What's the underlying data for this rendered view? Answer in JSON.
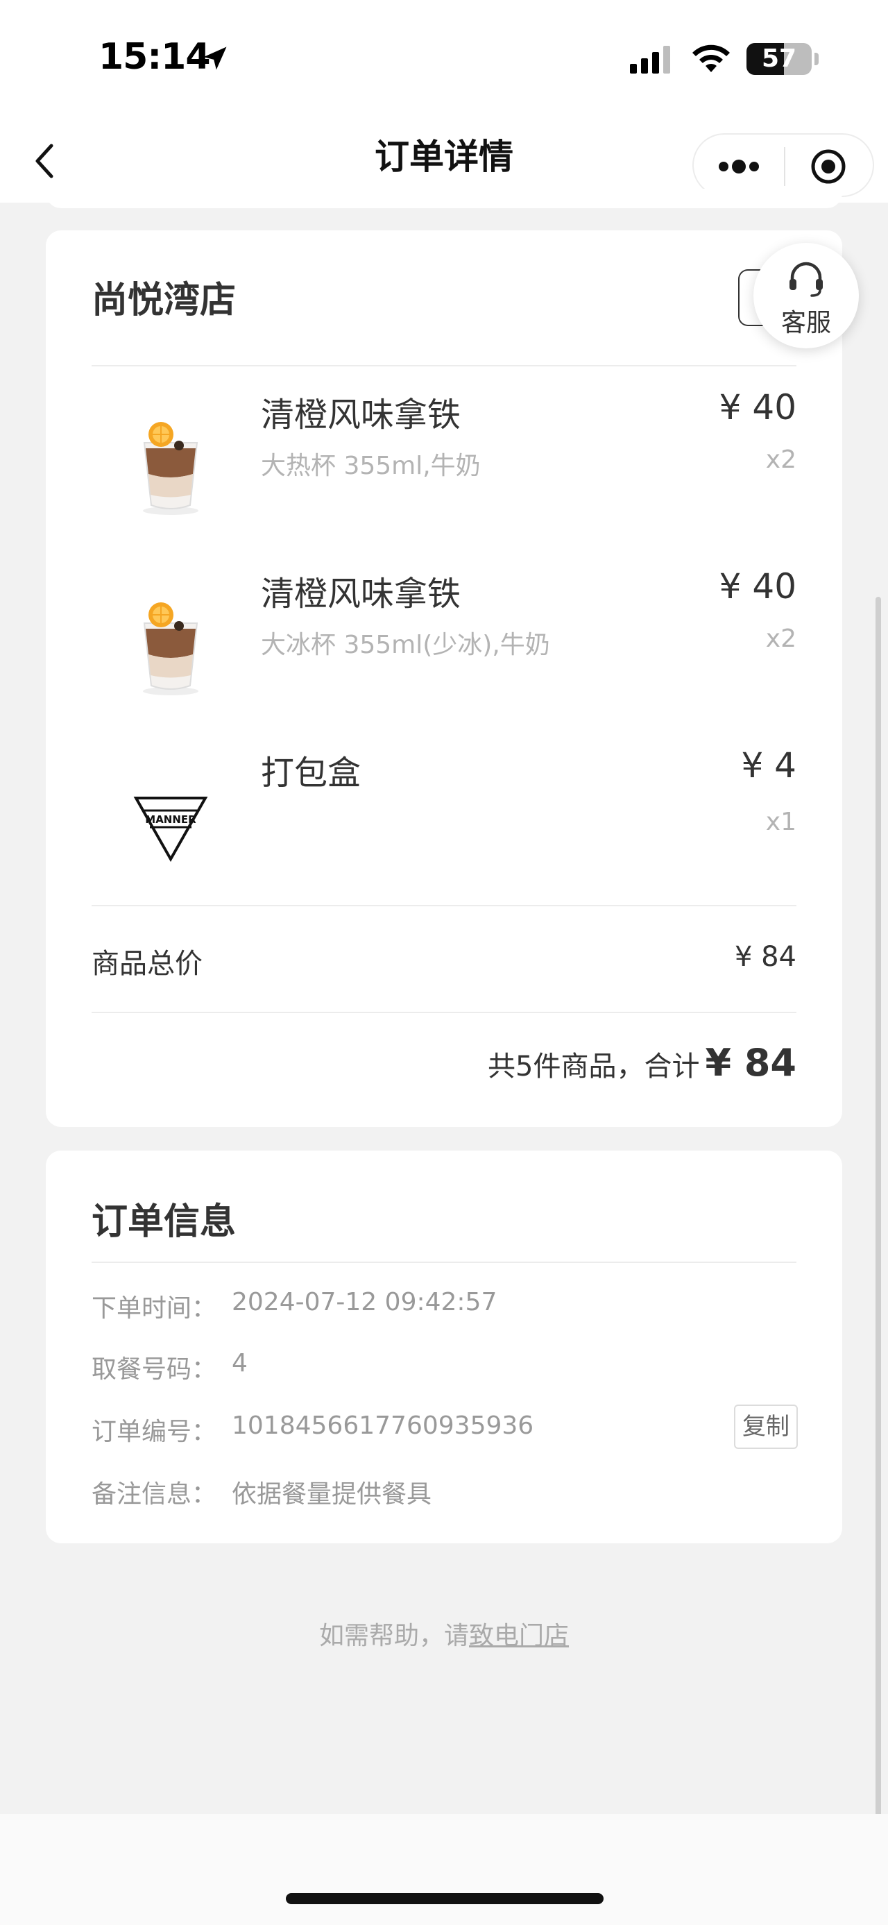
{
  "status_bar": {
    "time": "15:14",
    "battery_percent": "57",
    "battery_level": 0.57
  },
  "nav": {
    "title": "订单详情"
  },
  "store": {
    "name": "尚悦湾店",
    "items": [
      {
        "name": "清橙风味拿铁",
        "spec": "大热杯 355ml,牛奶",
        "price": "¥ 40",
        "qty": "x2",
        "image": "iced-orange-latte-cup"
      },
      {
        "name": "清橙风味拿铁",
        "spec": "大冰杯 355ml(少冰),牛奶",
        "price": "¥ 40",
        "qty": "x2",
        "image": "iced-orange-latte-cup"
      },
      {
        "name": "打包盒",
        "spec": "",
        "price": "¥ 4",
        "qty": "x1",
        "image": "manner-logo"
      }
    ],
    "subtotal_label": "商品总价",
    "subtotal_value": "¥ 84",
    "total_prefix": "共5件商品，合计",
    "total_value": "¥ 84"
  },
  "service": {
    "label": "客服"
  },
  "order_info": {
    "title": "订单信息",
    "rows": [
      {
        "label": "下单时间：",
        "value": "2024-07-12 09:42:57"
      },
      {
        "label": "取餐号码：",
        "value": "4"
      },
      {
        "label": "订单编号：",
        "value": "1018456617760935936"
      },
      {
        "label": "备注信息：",
        "value": "依据餐量提供餐具"
      }
    ],
    "copy_label": "复制"
  },
  "help": {
    "prefix": "如需帮助，请",
    "link": "致电门店"
  },
  "logo_text": "MANNER"
}
